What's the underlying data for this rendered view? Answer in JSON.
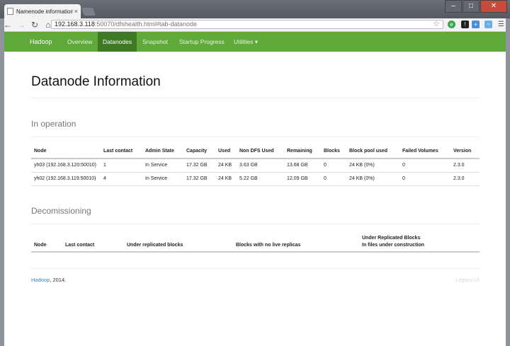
{
  "browser": {
    "tab_title": "Namenode information",
    "tab_close": "×",
    "window_controls": [
      "–",
      "□",
      "✕"
    ],
    "url_host": "192.168.3.118",
    "url_rest": ":50070/dfshealth.html#tab-datanode",
    "nav_icons": [
      "back-icon",
      "forward-icon",
      "reload-icon",
      "home-icon"
    ],
    "extension_icons": [
      "evernote-icon",
      "pin-icon",
      "extension-icon",
      "wallpaper-icon",
      "menu-icon"
    ]
  },
  "navbar": {
    "brand": "Hadoop",
    "items": [
      {
        "label": "Overview",
        "active": false
      },
      {
        "label": "Datanodes",
        "active": true
      },
      {
        "label": "Snapshot",
        "active": false
      },
      {
        "label": "Startup Progress",
        "active": false
      },
      {
        "label": "Utilities ▾",
        "active": false
      }
    ],
    "color": "#5fa83a"
  },
  "page": {
    "title": "Datanode Information",
    "in_operation": {
      "heading": "In operation",
      "columns": [
        "Node",
        "Last contact",
        "Admin State",
        "Capacity",
        "Used",
        "Non DFS Used",
        "Remaining",
        "Blocks",
        "Block pool used",
        "Failed Volumes",
        "Version"
      ],
      "rows": [
        [
          "yh03 (192.168.3.120:50010)",
          "1",
          "In Service",
          "17.32 GB",
          "24 KB",
          "3.63 GB",
          "13.68 GB",
          "0",
          "24 KB (0%)",
          "0",
          "2.3.0"
        ],
        [
          "yh02 (192.168.3.119:50010)",
          "4",
          "In Service",
          "17.32 GB",
          "24 KB",
          "5.22 GB",
          "12.09 GB",
          "0",
          "24 KB (0%)",
          "0",
          "2.3.0"
        ]
      ]
    },
    "decommissioning": {
      "heading": "Decomissioning",
      "columns": [
        "Node",
        "Last contact",
        "Under replicated blocks",
        "Blocks with no live replicas",
        "Under Replicated Blocks",
        "In files under construction"
      ]
    },
    "footer": {
      "link": "Hadoop",
      "year": ", 2014.",
      "legacy": "Legacy UI"
    }
  }
}
